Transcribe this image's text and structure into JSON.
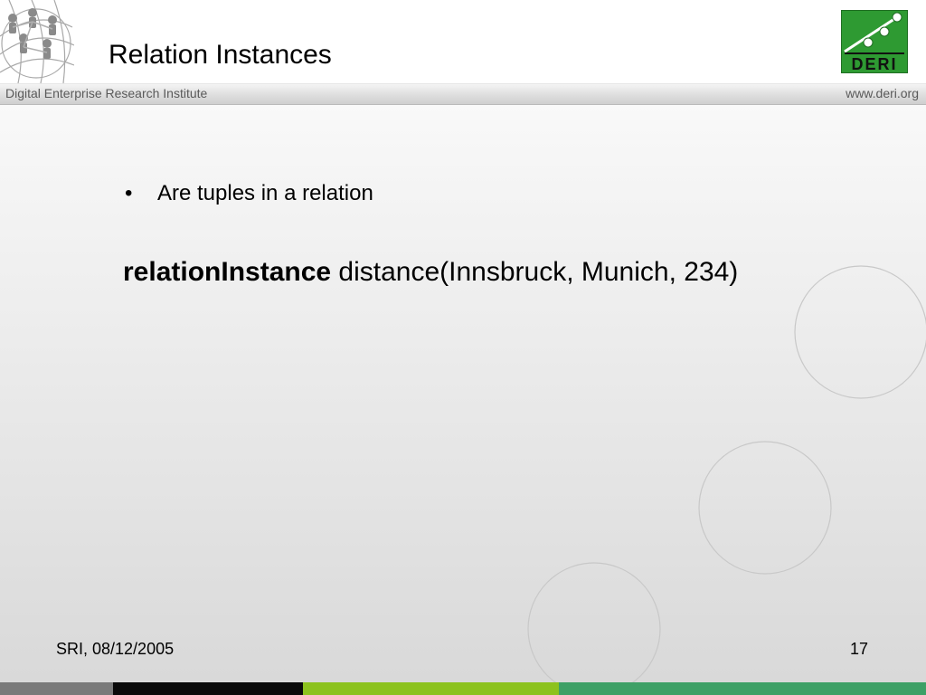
{
  "header": {
    "title": "Relation Instances",
    "logo_text": "DERI"
  },
  "band": {
    "left_text": "Digital Enterprise Research Institute",
    "right_text": "www.deri.org"
  },
  "content": {
    "bullet_symbol": "•",
    "bullet_text": "Are tuples in a relation",
    "keyword": "relationInstance",
    "statement": " distance(Innsbruck, Munich, 234)"
  },
  "footer": {
    "left": "SRI, 08/12/2005",
    "page_number": "17"
  },
  "colors": {
    "logo_green": "#2e9a32",
    "bar_gray": "#7a7a7a",
    "bar_black": "#0a0a0a",
    "bar_lime": "#8cc21e",
    "bar_green": "#3ea066"
  }
}
